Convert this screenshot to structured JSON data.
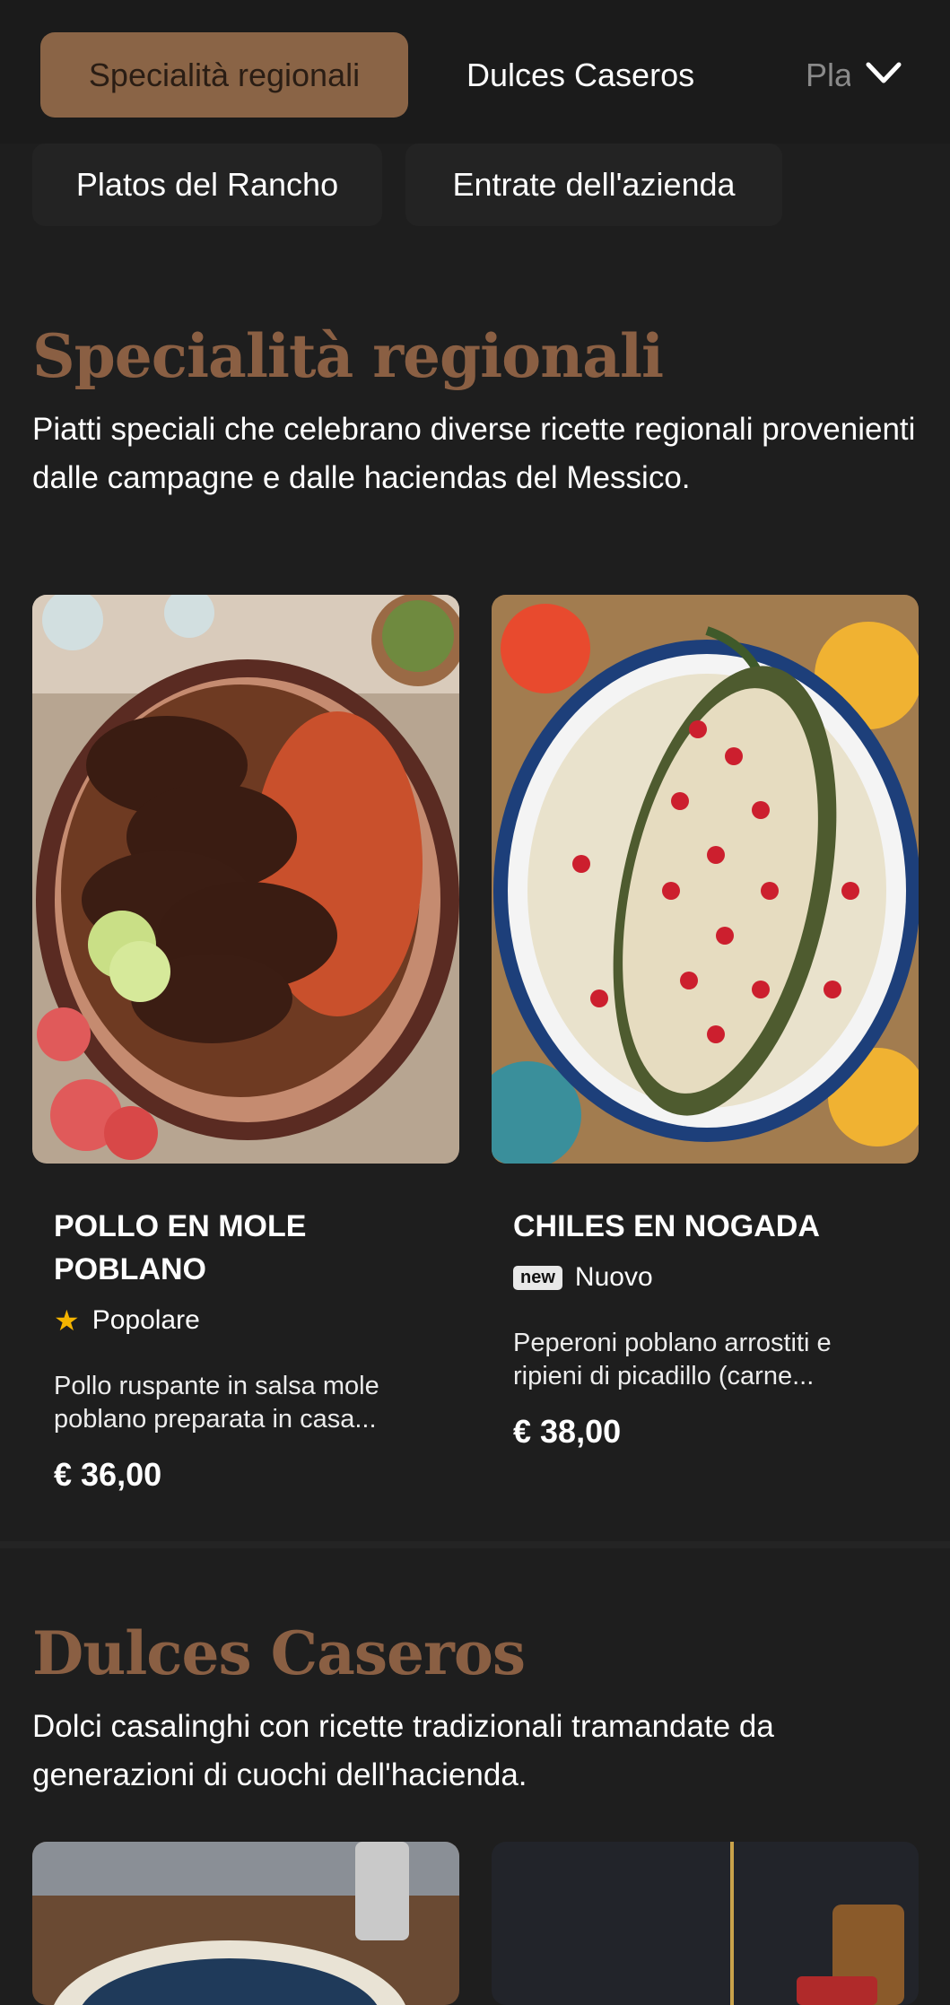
{
  "tabs": {
    "active": "Specialità regionali",
    "second": "Dulces Caseros",
    "third_partial": "Platos del Rancho",
    "row2": [
      "Platos del Rancho",
      "Entrate dell'azienda"
    ]
  },
  "sections": [
    {
      "title": "Specialità regionali",
      "description": "Piatti speciali che celebrano diverse ricette regionali provenienti dalle campagne e dalle haciendas del Messico.",
      "items": [
        {
          "name": "POLLO EN MOLE POBLANO",
          "tag": "Popolare",
          "tag_icon": "star-icon",
          "description": "Pollo ruspante in salsa mole poblano preparata in casa...",
          "price": "€ 36,00"
        },
        {
          "name": "CHILES EN NOGADA",
          "badge": "new",
          "tag": "Nuovo",
          "description": "Peperoni poblano arrostiti e ripieni di picadillo (carne...",
          "price": "€ 38,00"
        }
      ]
    },
    {
      "title": "Dulces Caseros",
      "description": "Dolci casalinghi con ricette tradizionali tramandate da generazioni di cuochi dell'hacienda."
    }
  ],
  "colors": {
    "background": "#1e1e1e",
    "accent": "#8a6446",
    "section_title": "#8a5f43",
    "star": "#f4b400"
  }
}
